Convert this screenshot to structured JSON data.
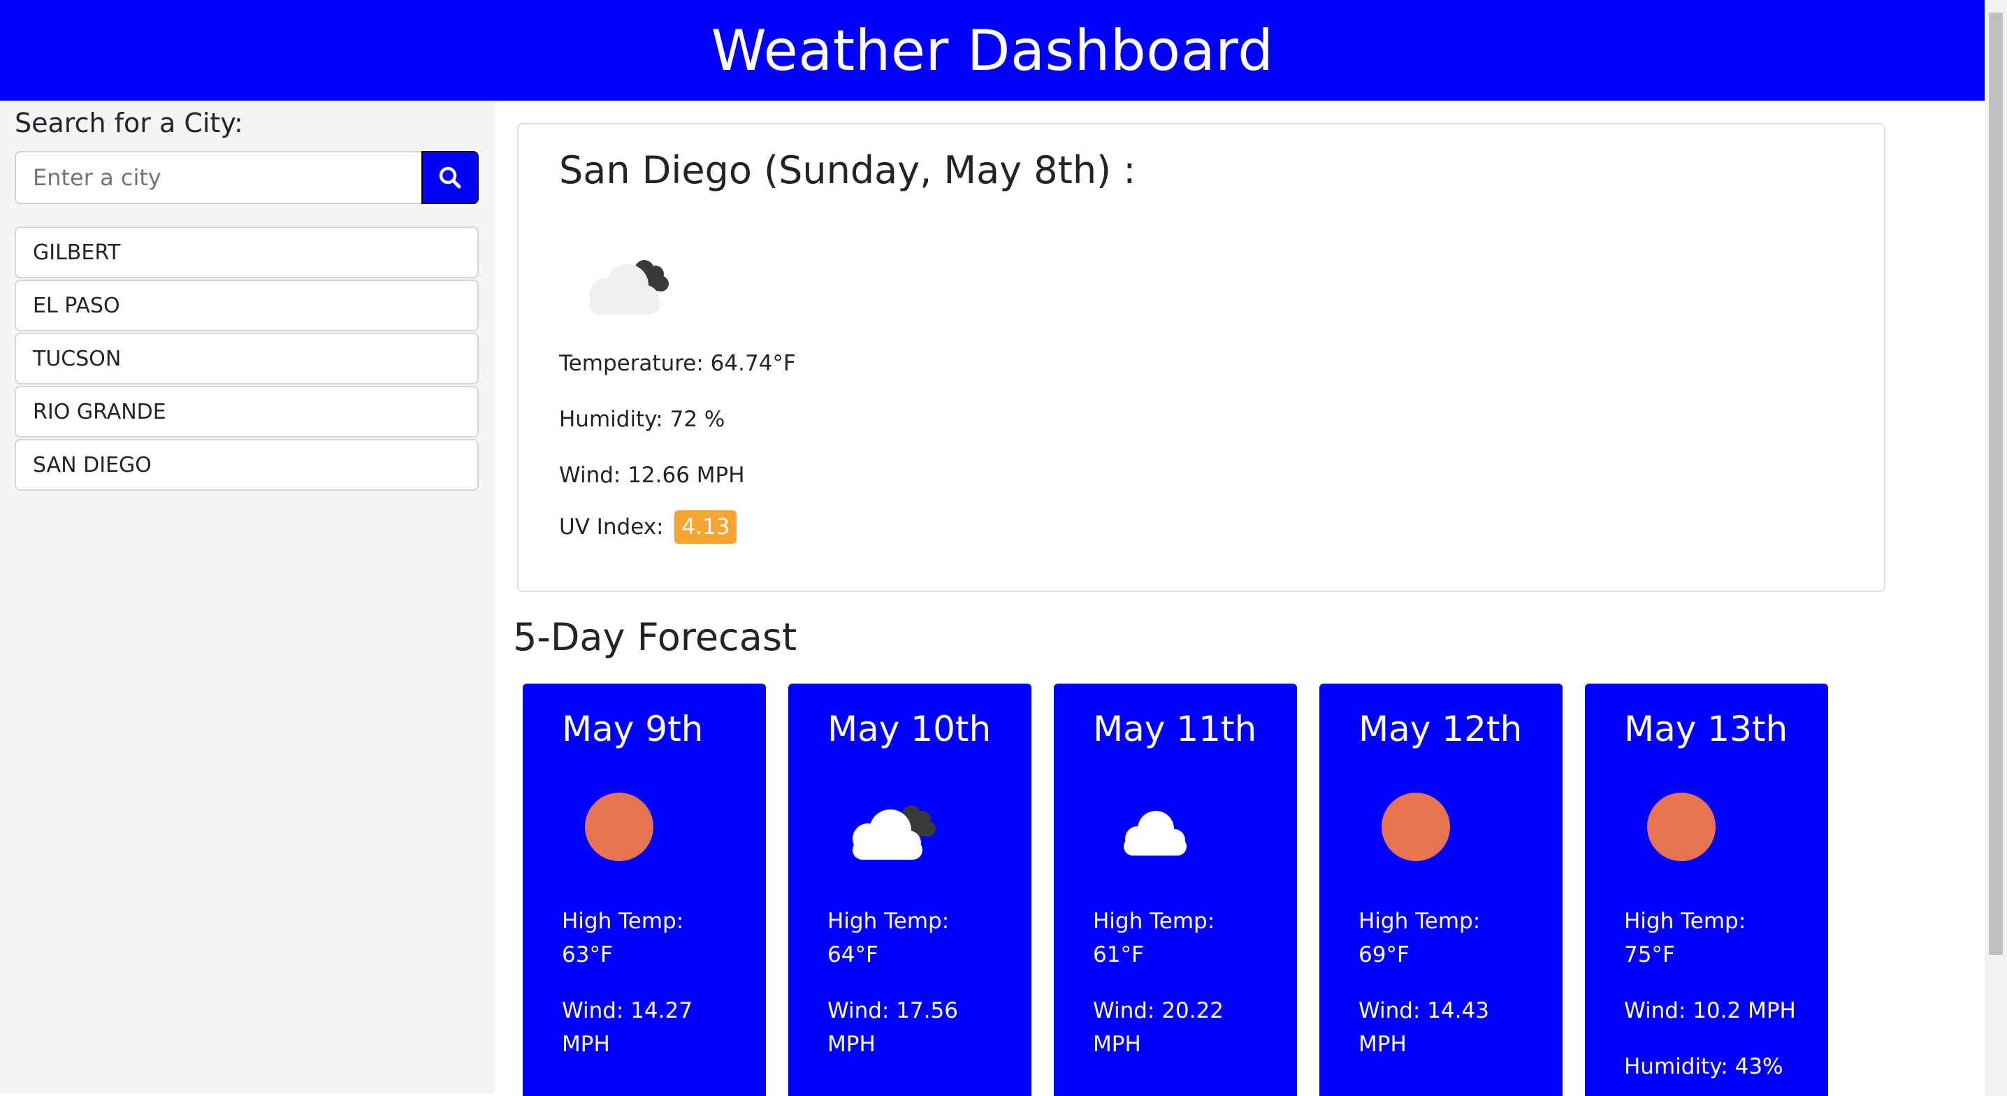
{
  "header": {
    "title": "Weather Dashboard"
  },
  "search": {
    "label": "Search for a City:",
    "placeholder": "Enter a city",
    "value": ""
  },
  "history": [
    "GILBERT",
    "EL PASO",
    "TUCSON",
    "RIO GRANDE",
    "SAN DIEGO"
  ],
  "current": {
    "title": "San Diego (Sunday, May 8th) :",
    "icon": "broken-clouds-icon",
    "temperature": "Temperature: 64.74°F",
    "humidity": "Humidity: 72 %",
    "wind": "Wind: 12.66 MPH",
    "uv_label": "UV Index:",
    "uv_value": "4.13",
    "uv_color": "#f8a431"
  },
  "forecast": {
    "heading": "5-Day Forecast",
    "days": [
      {
        "date": "May 9th",
        "icon": "sun-icon",
        "temp_label": "High Temp:",
        "temp": "63°F",
        "wind_label": "Wind: 14.27",
        "wind_unit": "MPH"
      },
      {
        "date": "May 10th",
        "icon": "broken-clouds-icon",
        "temp_label": "High Temp:",
        "temp": "64°F",
        "wind_label": "Wind: 17.56",
        "wind_unit": "MPH"
      },
      {
        "date": "May 11th",
        "icon": "cloud-icon",
        "temp_label": "High Temp:",
        "temp": "61°F",
        "wind_label": "Wind: 20.22",
        "wind_unit": "MPH"
      },
      {
        "date": "May 12th",
        "icon": "sun-icon",
        "temp_label": "High Temp:",
        "temp": "69°F",
        "wind_label": "Wind: 14.43",
        "wind_unit": "MPH"
      },
      {
        "date": "May 13th",
        "icon": "sun-icon",
        "temp_label": "High Temp:",
        "temp": "75°F",
        "wind_label": "Wind: 10.2 MPH",
        "humidity": "Humidity: 43%"
      }
    ]
  },
  "colors": {
    "primary": "#0000ff",
    "sun": "#e87351",
    "uv_moderate": "#f8a431"
  }
}
